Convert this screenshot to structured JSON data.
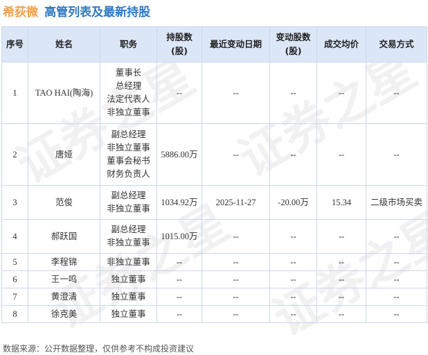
{
  "header": {
    "company": "希荻微",
    "title": "高管列表及最新持股"
  },
  "table": {
    "columns": [
      "序号",
      "姓名",
      "职务",
      "持股数\n(股)",
      "最近变动日期",
      "变动股数\n(股)",
      "成交均价",
      "交易方式"
    ],
    "rows": [
      {
        "no": "1",
        "name": "TAO HAI(陶海)",
        "roles": [
          "董事长",
          "总经理",
          "法定代表人",
          "非独立董事"
        ],
        "shares": "--",
        "date": "--",
        "change": "--",
        "price": "--",
        "method": "--"
      },
      {
        "no": "2",
        "name": "唐娅",
        "roles": [
          "副总经理",
          "非独立董事",
          "董事会秘书",
          "财务负责人"
        ],
        "shares": "5886.00万",
        "date": "--",
        "change": "--",
        "price": "--",
        "method": "--"
      },
      {
        "no": "3",
        "name": "范俊",
        "roles": [
          "副总经理",
          "非独立董事"
        ],
        "shares": "1034.92万",
        "date": "2025-11-27",
        "change": "-20.00万",
        "price": "15.34",
        "method": "二级市场买卖"
      },
      {
        "no": "4",
        "name": "郝跃国",
        "roles": [
          "副总经理",
          "非独立董事"
        ],
        "shares": "1015.00万",
        "date": "--",
        "change": "--",
        "price": "--",
        "method": "--"
      },
      {
        "no": "5",
        "name": "李程锦",
        "roles": [
          "非独立董事"
        ],
        "shares": "--",
        "date": "--",
        "change": "--",
        "price": "--",
        "method": "--"
      },
      {
        "no": "6",
        "name": "王一鸣",
        "roles": [
          "独立董事"
        ],
        "shares": "--",
        "date": "--",
        "change": "--",
        "price": "--",
        "method": "--"
      },
      {
        "no": "7",
        "name": "黄澄清",
        "roles": [
          "独立董事"
        ],
        "shares": "--",
        "date": "--",
        "change": "--",
        "price": "--",
        "method": "--"
      },
      {
        "no": "8",
        "name": "徐克美",
        "roles": [
          "独立董事"
        ],
        "shares": "--",
        "date": "--",
        "change": "--",
        "price": "--",
        "method": "--"
      }
    ]
  },
  "footer": {
    "source": "数据来源：公开数据整理，仅供参考不构成投资建议"
  },
  "colors": {
    "company": "#f0a049",
    "title": "#2f78c4",
    "header_bg": "#dbe7f7",
    "border": "#c9d7ec",
    "change_negative": "#2e9a3c",
    "price": "#2e9a3c"
  }
}
